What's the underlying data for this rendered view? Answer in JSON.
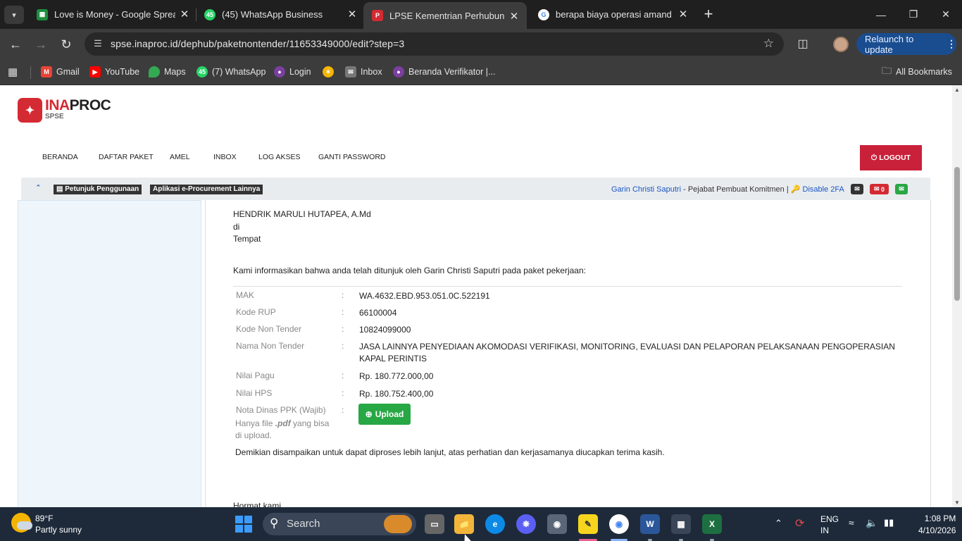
{
  "browser": {
    "tabs": [
      {
        "title": "Love is Money - Google Spreadsheet",
        "favicon": "sheets-icon",
        "color": "#1e8e3e"
      },
      {
        "title": "(45) WhatsApp Business",
        "favicon": "whatsapp-icon",
        "color": "#25d366",
        "badge": "45"
      },
      {
        "title": "LPSE Kementrian Perhubungan",
        "favicon": "lpse-icon",
        "color": "#d42a33",
        "active": true
      },
      {
        "title": "berapa biaya operasi amandel",
        "favicon": "google-icon",
        "color": "#4285f4"
      }
    ],
    "url": "spse.inaproc.id/dephub/paketnontender/11653349000/edit?step=3",
    "relaunch_label": "Relaunch to update",
    "bookmarks": [
      {
        "label": "Gmail",
        "icon": "gmail-icon",
        "color": "#ea4335"
      },
      {
        "label": "YouTube",
        "icon": "youtube-icon",
        "color": "#ff0000"
      },
      {
        "label": "Maps",
        "icon": "maps-icon",
        "color": "#34a853"
      },
      {
        "label": "(7) WhatsApp",
        "icon": "whatsapp-icon",
        "color": "#25d366",
        "badge": "45"
      },
      {
        "label": "Login",
        "icon": "login-icon",
        "color": "#7b3fa0"
      },
      {
        "label": "",
        "icon": "pinwheel-icon",
        "color": "#f4b400"
      },
      {
        "label": "Inbox",
        "icon": "mail-icon",
        "color": "#777777"
      },
      {
        "label": "Beranda Verifikator |...",
        "icon": "verifikator-icon",
        "color": "#7b3fa0"
      }
    ],
    "all_bookmarks_label": "All Bookmarks"
  },
  "site": {
    "logo_ina": "INA",
    "logo_proc": "PROC",
    "logo_sub": "SPSE",
    "nav": [
      "BERANDA",
      "DAFTAR PAKET",
      "AMEL",
      "INBOX",
      "LOG AKSES",
      "GANTI PASSWORD"
    ],
    "logout_label": "LOGOUT",
    "help_label": "Petunjuk Penggunaan",
    "apps_label": "Aplikasi e-Procurement Lainnya",
    "user_name": "Garin Christi Saputri",
    "user_role": " - Pejabat Pembuat Komitmen | ",
    "disable_2fa": "Disable 2FA",
    "mail_count": "0"
  },
  "letter": {
    "addressee": "HENDRIK MARULI HUTAPEA, A.Md",
    "di": "di",
    "tempat": "Tempat",
    "intro": "Kami informasikan bahwa anda telah ditunjuk oleh Garin Christi Saputri pada paket pekerjaan:",
    "rows": [
      {
        "label": "MAK",
        "value": "WA.4632.EBD.953.051.0C.522191"
      },
      {
        "label": "Kode RUP",
        "value": "66100004"
      },
      {
        "label": "Kode Non Tender",
        "value": "10824099000"
      },
      {
        "label": "Nama Non Tender",
        "value": "JASA LAINNYA PENYEDIAAN AKOMODASI VERIFIKASI, MONITORING, EVALUASI DAN PELAPORAN PELAKSANAAN PENGOPERASIAN KAPAL PERINTIS"
      },
      {
        "label": "Nilai Pagu",
        "value": "Rp. 180.772.000,00"
      },
      {
        "label": "Nilai HPS",
        "value": "Rp. 180.752.400,00"
      },
      {
        "label": "Nota Dinas PPK (Wajib)",
        "value": ""
      }
    ],
    "colon": ":",
    "upload_label": "Upload",
    "note_prefix": "Hanya file ",
    "note_ext": ".pdf",
    "note_suffix": " yang bisa di upload.",
    "closing": "Demikian disampaikan untuk dapat diproses lebih lanjut, atas perhatian dan kerjasamanya diucapkan terima kasih.",
    "hormat": "Hormat kami,"
  },
  "taskbar": {
    "temperature": "89°F",
    "weather": "Partly sunny",
    "search_label": "Search",
    "lang": "ENG",
    "region": "IN",
    "time": "1:08 PM",
    "date": "4/10/2026"
  }
}
